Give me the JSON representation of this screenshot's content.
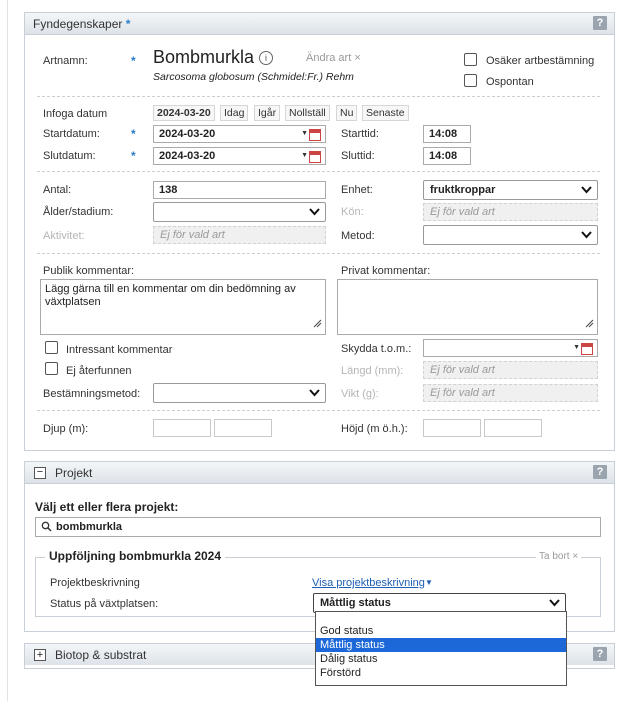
{
  "fyndegenskaper": {
    "title": "Fyndegenskaper",
    "title_star": "*",
    "help": "?",
    "artnamn_label": "Artnamn:",
    "species_name": "Bombmurkla",
    "info_icon": "i",
    "andra_art": "Ändra art",
    "remove_icon": "×",
    "scientific_name": "Sarcosoma globosum (Schmidel:Fr.) Rehm",
    "osaker_label": "Osäker artbestämning",
    "ospontan_label": "Ospontan",
    "infoga_label": "Infoga datum",
    "date_buttons": [
      "2024-03-20",
      "Idag",
      "Igår",
      "Nollställ",
      "Nu",
      "Senaste"
    ],
    "startdatum_label": "Startdatum:",
    "startdatum_value": "2024-03-20",
    "starttid_label": "Starttid:",
    "starttid_value": "14:08",
    "slutdatum_label": "Slutdatum:",
    "slutdatum_value": "2024-03-20",
    "sluttid_label": "Sluttid:",
    "sluttid_value": "14:08",
    "antal_label": "Antal:",
    "antal_value": "138",
    "enhet_label": "Enhet:",
    "enhet_value": "fruktkroppar",
    "alder_label": "Ålder/stadium:",
    "alder_value": "",
    "kon_label": "Kön:",
    "ej_for_vald_art": "Ej för vald art",
    "aktivitet_label": "Aktivitet:",
    "metod_label": "Metod:",
    "metod_value": "",
    "publik_label": "Publik kommentar:",
    "publik_placeholder": "Lägg gärna till en kommentar om din bedömning av växtplatsen",
    "privat_label": "Privat kommentar:",
    "intressant_label": "Intressant kommentar",
    "ej_aterfunnen_label": "Ej återfunnen",
    "skydda_label": "Skydda t.o.m.:",
    "langd_label": "Längd (mm):",
    "bestamning_label": "Bestämningsmetod:",
    "vikt_label": "Vikt (g):",
    "djup_label": "Djup (m):",
    "hojd_label": "Höjd (m ö.h.):"
  },
  "projekt": {
    "title": "Projekt",
    "collapse_glyph": "−",
    "help": "?",
    "valj_label": "Välj ett eller flera projekt:",
    "search_value": "bombmurkla",
    "project_title": "Uppföljning bombmurkla 2024",
    "ta_bort": "Ta bort",
    "beskrivning_label": "Projektbeskrivning",
    "visa_link": "Visa projektbeskrivning",
    "status_label": "Status på växtplatsen:",
    "status_value": "Måttlig status",
    "status_options": [
      "God status",
      "Måttlig status",
      "Dålig status",
      "Förstörd"
    ]
  },
  "biotop": {
    "title": "Biotop & substrat",
    "expand_glyph": "+",
    "help": "?"
  },
  "colors": {
    "required_star": "#2a7cc7",
    "link": "#1e5fb3",
    "selected_option": "#1d68d9"
  }
}
